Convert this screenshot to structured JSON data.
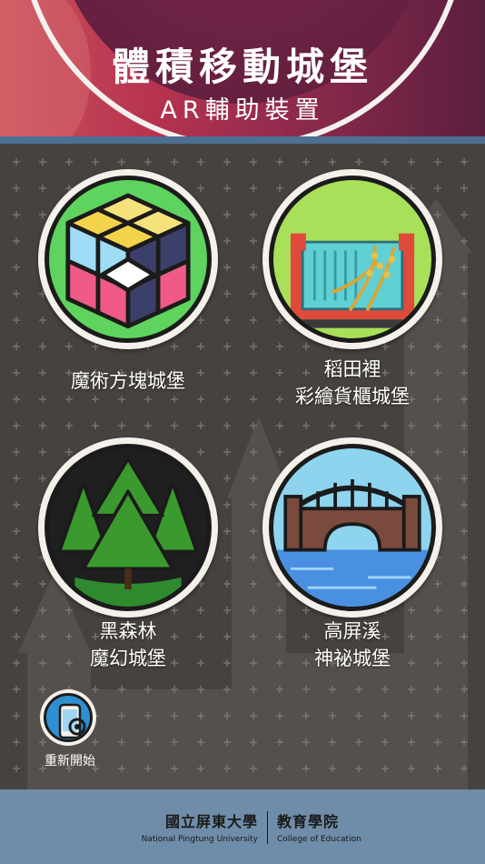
{
  "header": {
    "title": "體積移動城堡",
    "subtitle": "AR輔助裝置"
  },
  "cards": [
    {
      "label_lines": [
        "魔術方塊城堡"
      ],
      "icon": "rubiks-cube-icon",
      "color": "#5ed35e"
    },
    {
      "label_lines": [
        "稻田裡",
        "彩繪貨櫃城堡"
      ],
      "icon": "container-rice-field-icon",
      "color": "#a8e05a"
    },
    {
      "label_lines": [
        "黑森林",
        "魔幻城堡"
      ],
      "icon": "pine-forest-icon",
      "color": "#1f1f1f"
    },
    {
      "label_lines": [
        "高屏溪",
        "神祕城堡"
      ],
      "icon": "bridge-river-icon",
      "color": "#8fd4ee"
    }
  ],
  "restart": {
    "label": "重新開始",
    "icon": "phone-ar-icon"
  },
  "footer": {
    "university_zh": "國立屏東大學",
    "university_en": "National Pingtung University",
    "college_zh": "教育學院",
    "college_en": "College of Education"
  }
}
